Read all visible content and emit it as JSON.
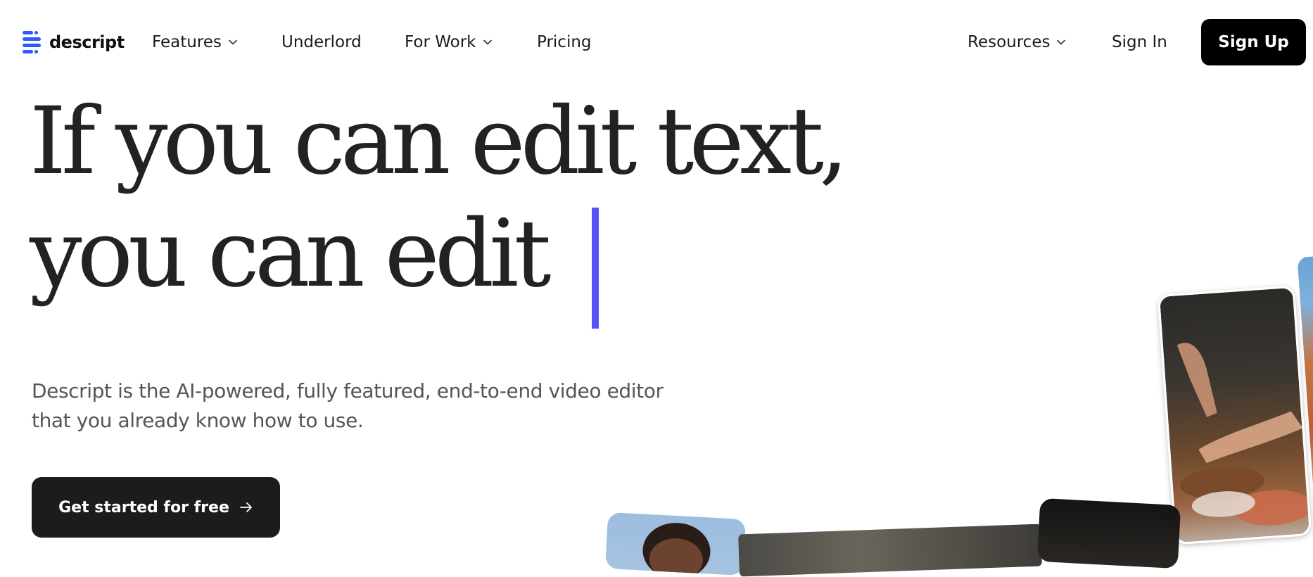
{
  "header": {
    "logo_text": "descript",
    "logo_icon": "descript-logo-icon",
    "nav": [
      {
        "label": "Features",
        "has_dropdown": true
      },
      {
        "label": "Underlord",
        "has_dropdown": false
      },
      {
        "label": "For Work",
        "has_dropdown": true
      },
      {
        "label": "Pricing",
        "has_dropdown": false
      }
    ],
    "resources_label": "Resources",
    "sign_in_label": "Sign In",
    "sign_up_label": "Sign Up"
  },
  "hero": {
    "headline_line1": "If you can edit text,",
    "headline_line2": "you can edit",
    "caret_color": "#5454f4",
    "subtitle_line1": "Descript is the AI-powered, fully featured, end-to-end video editor",
    "subtitle_line2": "that you already know how to use.",
    "cta_label": "Get started for free",
    "cta_icon": "arrow-right-icon"
  },
  "colors": {
    "accent": "#5454f4",
    "logo_blue": "#2e5bff",
    "button_dark": "#000000",
    "cta_dark": "#1c1c1c",
    "text": "#1b1b1b",
    "subtitle_text": "#555555"
  }
}
